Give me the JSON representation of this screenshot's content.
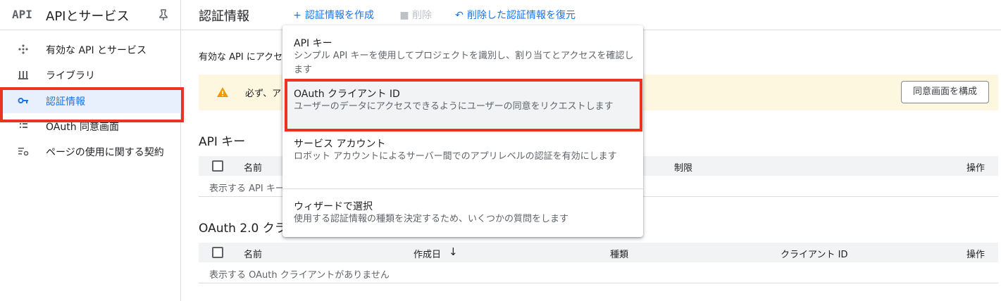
{
  "sidebar": {
    "logo": "API",
    "title": "APIとサービス",
    "items": [
      {
        "label": "有効な API とサービス",
        "icon": "dashboard-icon"
      },
      {
        "label": "ライブラリ",
        "icon": "library-icon"
      },
      {
        "label": "認証情報",
        "icon": "key-icon",
        "active": true
      },
      {
        "label": "OAuth 同意画面",
        "icon": "consent-icon"
      },
      {
        "label": "ページの使用に関する契約",
        "icon": "settings-list-icon"
      }
    ]
  },
  "header": {
    "title": "認証情報",
    "create_label": "認証情報を作成",
    "delete_label": "削除",
    "restore_label": "削除した認証情報を復元"
  },
  "content": {
    "intro_text": "有効な API にアクセ",
    "banner_text": "必ず、ア",
    "consent_button": "同意画面を構成",
    "api_keys_title": "API キー",
    "api_keys_columns": [
      "名前",
      "制限",
      "操作"
    ],
    "api_keys_empty": "表示する API キー",
    "oauth_title": "OAuth 2.0 クラ",
    "oauth_columns": [
      "名前",
      "作成日",
      "種類",
      "クライアント ID",
      "操作"
    ],
    "oauth_empty": "表示する OAuth クライアントがありません"
  },
  "menu": {
    "items": [
      {
        "title": "API キー",
        "desc": "シンプル API キーを使用してプロジェクトを識別し、割り当てとアクセスを確認します"
      },
      {
        "title": "OAuth クライアント ID",
        "desc": "ユーザーのデータにアクセスできるようにユーザーの同意をリクエストします"
      },
      {
        "title": "サービス アカウント",
        "desc": "ロボット アカウントによるサーバー間でのアプリレベルの認証を有効にします"
      },
      {
        "title": "ウィザードで選択",
        "desc": "使用する認証情報の種類を決定するため、いくつかの質問をします"
      }
    ]
  },
  "colors": {
    "accent": "#1a73e8",
    "highlight": "#ea3323",
    "warning": "#f29900"
  }
}
